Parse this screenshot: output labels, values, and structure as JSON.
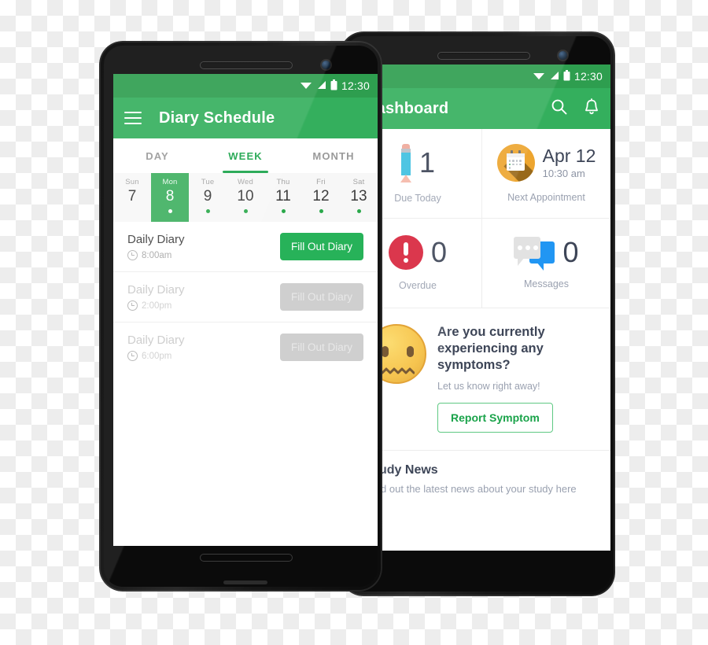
{
  "left_phone": {
    "status_bar": {
      "time": "12:30",
      "wifi_icon": "wifi-icon",
      "signal_icon": "signal-icon",
      "battery_icon": "battery-icon"
    },
    "app_bar": {
      "menu_icon": "hamburger-menu-icon",
      "title": "Diary Schedule"
    },
    "tabs": [
      {
        "label": "DAY",
        "active": false
      },
      {
        "label": "WEEK",
        "active": true
      },
      {
        "label": "MONTH",
        "active": false
      }
    ],
    "week_strip": [
      {
        "dow": "Sun",
        "date": "7",
        "selected": false,
        "dot": "none"
      },
      {
        "dow": "Mon",
        "date": "8",
        "selected": true,
        "dot": "white"
      },
      {
        "dow": "Tue",
        "date": "9",
        "selected": false,
        "dot": "green"
      },
      {
        "dow": "Wed",
        "date": "10",
        "selected": false,
        "dot": "green"
      },
      {
        "dow": "Thu",
        "date": "11",
        "selected": false,
        "dot": "green"
      },
      {
        "dow": "Fri",
        "date": "12",
        "selected": false,
        "dot": "green"
      },
      {
        "dow": "Sat",
        "date": "13",
        "selected": false,
        "dot": "green"
      }
    ],
    "diary_rows": [
      {
        "title": "Daily Diary",
        "time": "8:00am",
        "button": "Fill Out Diary",
        "enabled": true
      },
      {
        "title": "Daily Diary",
        "time": "2:00pm",
        "button": "Fill Out Diary",
        "enabled": false
      },
      {
        "title": "Daily Diary",
        "time": "6:00pm",
        "button": "Fill Out Diary",
        "enabled": false
      }
    ]
  },
  "right_phone": {
    "status_bar": {
      "time": "12:30",
      "wifi_icon": "wifi-icon",
      "signal_icon": "signal-icon",
      "battery_icon": "battery-icon"
    },
    "app_bar": {
      "title": "Dashboard",
      "search_icon": "search-icon",
      "bell_icon": "notification-bell-icon"
    },
    "stats": [
      {
        "value": "1",
        "label": "Due Today",
        "icon": "pencil-icon"
      },
      {
        "value": "Apr 12",
        "sub": "10:30 am",
        "label": "Next Appointment",
        "icon": "calendar-icon"
      },
      {
        "value": "0",
        "label": "Overdue",
        "icon": "overdue-alert-icon"
      },
      {
        "value": "0",
        "label": "Messages",
        "icon": "chat-bubbles-icon"
      }
    ],
    "symptom_card": {
      "icon": "confused-face-emoji",
      "question": "Are you currently experiencing any symptoms?",
      "subtitle": "Let us know right away!",
      "button": "Report Symptom"
    },
    "news_card": {
      "title": "Study News",
      "subtitle": "Find out the latest news about your study here"
    }
  },
  "colors": {
    "status_bar_green": "#2e9e4f",
    "app_bar_green": "#34af5d",
    "accent_green": "#1aa34a",
    "button_green": "#27b259",
    "disabled_grey": "#cfcfcf",
    "text_dark": "#3d4557",
    "text_muted": "#9aa1b0",
    "orange": "#eda52f",
    "red": "#d8243c",
    "blue": "#2196f3"
  }
}
